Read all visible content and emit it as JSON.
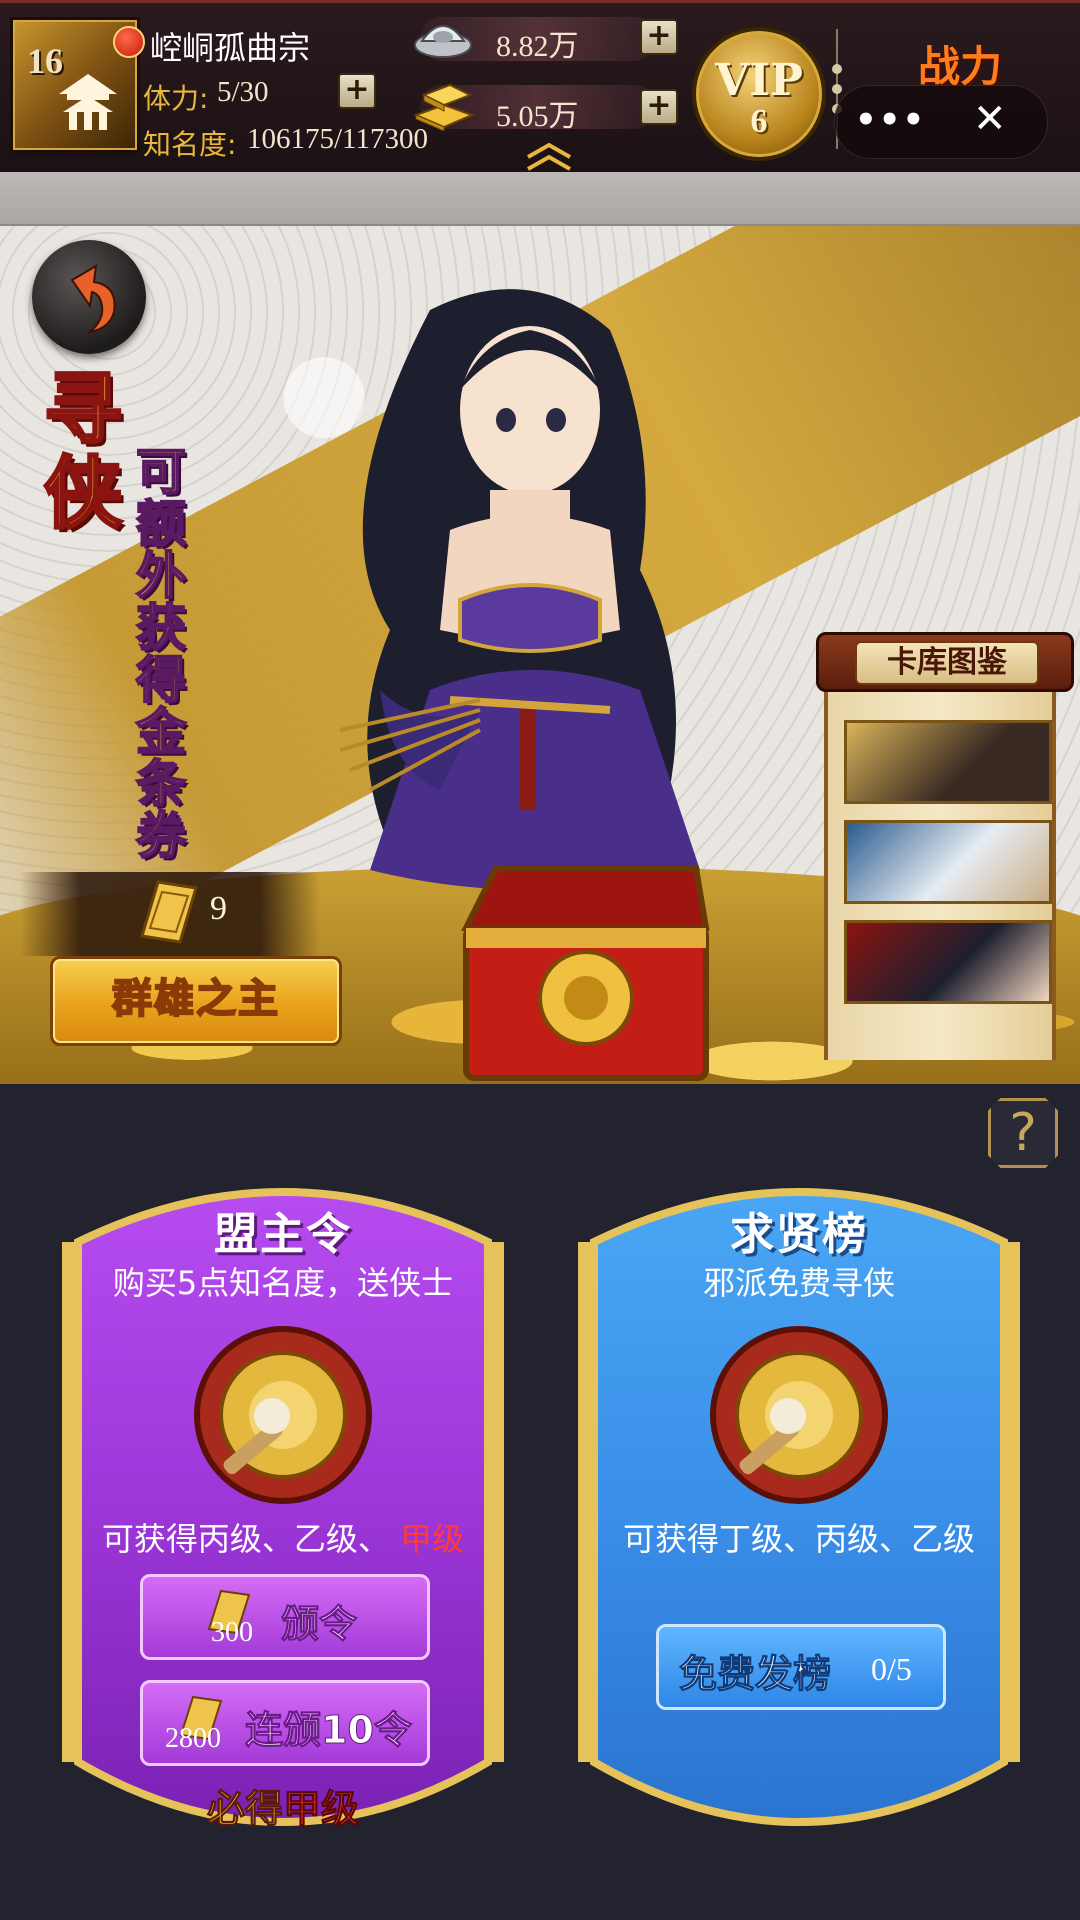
{
  "player": {
    "level": "16",
    "name": "崆峒孤曲宗",
    "stamina_label": "体力:",
    "stamina_value": "5/30",
    "fame_label": "知名度:",
    "fame_value": "106175/117300"
  },
  "resources": {
    "silver": "8.82万",
    "gold": "5.05万"
  },
  "vip": {
    "label": "VIP",
    "level": "6"
  },
  "power": {
    "label": "战力"
  },
  "capsule": {
    "more": "•••",
    "close": "✕"
  },
  "banner": {
    "title_big": "寻侠",
    "title_small": "可额外获得金条券",
    "ticket_count": "9",
    "lord_button": "群雄之主",
    "gallery_title": "卡库图鉴"
  },
  "help": {
    "label": "?"
  },
  "panels": [
    {
      "title": "盟主令",
      "subtitle": "购买5点知名度，送侠士",
      "grades_prefix": "可获得丙级、乙级、",
      "grades_red": "甲级",
      "btn1_label": "颁令",
      "btn1_price": "300",
      "btn2_label": "连颁10令",
      "btn2_price": "2800",
      "must_prefix": "必得",
      "must_red": "甲级"
    },
    {
      "title": "求贤榜",
      "subtitle": "邪派免费寻侠",
      "grades": "可获得丁级、丙级、乙级",
      "btn_label": "免费发榜",
      "btn_count": "0/5"
    }
  ],
  "colors": {
    "purple_panel": "#a93ce0",
    "blue_panel": "#3a8fe8",
    "gold_frame": "#e6c35a",
    "accent_gold": "#e9b73a"
  }
}
